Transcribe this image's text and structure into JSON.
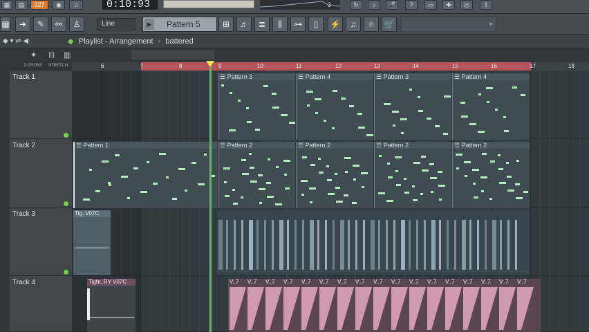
{
  "top": {
    "time": "0:10:93",
    "pattern_badge": "327",
    "counter": "3"
  },
  "toolbar": {
    "snap_value": "Line",
    "pattern_name": "Pattern 5"
  },
  "playlist": {
    "title": "Playlist - Arrangement",
    "breadcrumb": "battered"
  },
  "ruler": {
    "left_labels": [
      "Z-CROSS",
      "STRETCH"
    ],
    "ticks": [
      "6",
      "7",
      "8",
      "9",
      "10",
      "11",
      "12",
      "13",
      "14",
      "15",
      "16",
      "17",
      "18"
    ]
  },
  "tracks": [
    {
      "name": "Track 1"
    },
    {
      "name": "Track 2"
    },
    {
      "name": "Track 3"
    },
    {
      "name": "Track 4"
    }
  ],
  "clips": {
    "track1": [
      "Pattern 3",
      "Pattern 4",
      "Pattern 3",
      "Pattern 4"
    ],
    "track2_first": "Pattern 1",
    "track2": [
      "Pattern 2",
      "Pattern 2",
      "Pattern 2",
      "Pattern 2"
    ],
    "track3_first": "Tig..V07C",
    "track4_first": "Tight..RY V07C",
    "track4_repeat": "V..7"
  },
  "colors": {
    "loop_bar": "#b8525b",
    "playhead": "#56c24a",
    "note": "#b4ecbf",
    "audio": "#a9c7d3",
    "pink": "#e4a9c1"
  }
}
